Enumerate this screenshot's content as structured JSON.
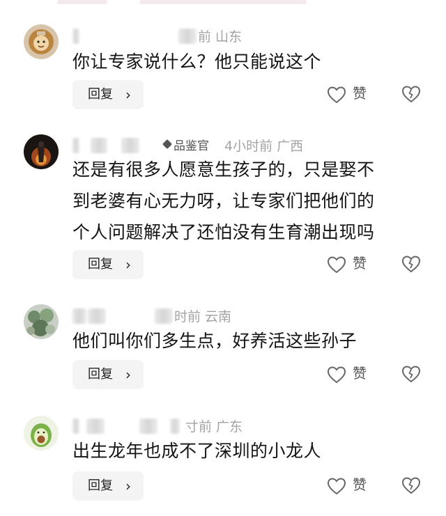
{
  "comments": [
    {
      "meta": "前  山东",
      "badge": "",
      "content": [
        "你让专家说什么？他只能说这个"
      ],
      "reply_label": "回复",
      "like_label": "赞"
    },
    {
      "meta": "4小时前  广西",
      "badge": "品鉴官",
      "content": [
        "还是有很多人愿意生孩子的，只是娶不",
        "到老婆有心无力呀，让专家们把他们的",
        "个人问题解决了还怕没有生育潮出现吗"
      ],
      "reply_label": "回复",
      "like_label": "赞"
    },
    {
      "meta": "时前  云南",
      "badge": "",
      "content": [
        "他们叫你们多生点，好养活这些孙子"
      ],
      "reply_label": "回复",
      "like_label": "赞"
    },
    {
      "meta": "寸前  广东",
      "badge": "",
      "content": [
        "出生龙年也成不了深圳的小龙人"
      ],
      "reply_label": "回复",
      "like_label": "赞"
    }
  ],
  "icons": {
    "like": "heart-outline-icon",
    "dislike": "broken-heart-icon",
    "reply_chevron": "chevron-right-icon"
  },
  "colors": {
    "meta_gray": "#a3a3a3",
    "reply_bg": "#f4f4f4",
    "text": "#141414"
  }
}
